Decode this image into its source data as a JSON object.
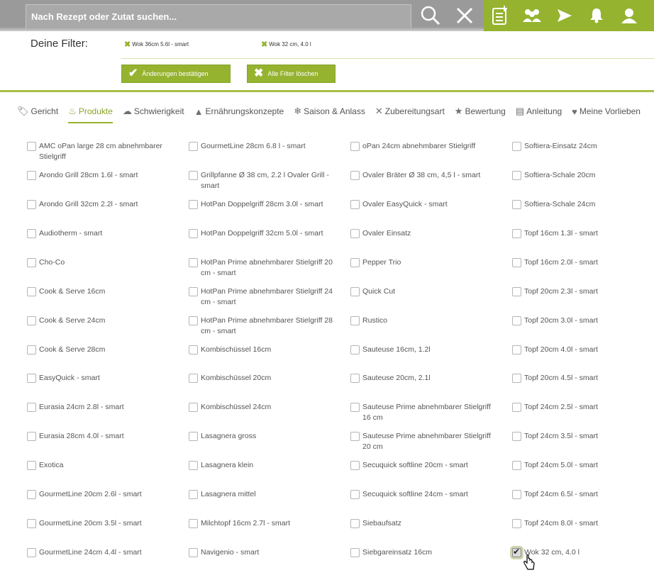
{
  "search": {
    "placeholder": "Nach Rezept oder Zutat suchen..."
  },
  "header_icons": [
    "search-icon",
    "close-icon",
    "recipe-book-icon",
    "community-icon",
    "send-icon",
    "bell-icon",
    "user-icon"
  ],
  "colors": {
    "accent": "#95b32f",
    "header": "#9a9a9a",
    "text": "#555555"
  },
  "filters": {
    "label": "Deine Filter:",
    "chips": [
      "Wok 36cm 5.6l - smart",
      "Wok 32 cm, 4.0 l"
    ],
    "confirm_label": "Änderungen bestätigen",
    "clear_label": "Alle Filter löschen"
  },
  "tabs": [
    {
      "label": "Gericht",
      "icon": "tag-icon"
    },
    {
      "label": "Produkte",
      "icon": "pot-icon",
      "active": true
    },
    {
      "label": "Schwierigkeit",
      "icon": "chef-hat-icon"
    },
    {
      "label": "Ernährungskonzepte",
      "icon": "pyramid-icon"
    },
    {
      "label": "Saison & Anlass",
      "icon": "snowflake-icon"
    },
    {
      "label": "Zubereitungsart",
      "icon": "utensils-icon"
    },
    {
      "label": "Bewertung",
      "icon": "star-icon"
    },
    {
      "label": "Anleitung",
      "icon": "document-icon"
    },
    {
      "label": "Meine Vorlieben",
      "icon": "heart-icon"
    }
  ],
  "products": {
    "col1": [
      "AMC oPan large 28 cm abnehmbarer Stielgriff",
      "Arondo Grill 28cm 1.6l - smart",
      "Arondo Grill 32cm 2.2l - smart",
      "Audiotherm - smart",
      "Cho-Co",
      "Cook & Serve 16cm",
      "Cook & Serve 24cm",
      "Cook & Serve 28cm",
      "EasyQuick - smart",
      "Eurasia 24cm 2.8l - smart",
      "Eurasia 28cm 4.0l - smart",
      "Exotica",
      "GourmetLine 20cm 2.6l - smart",
      "GourmetLine 20cm 3.5l - smart",
      "GourmetLine 24cm 4.4l - smart"
    ],
    "col2": [
      "GourmetLine 28cm 6.8 l - smart",
      "Grillpfanne Ø 38 cm, 2.2 l Ovaler Grill - smart",
      "HotPan Doppelgriff 28cm 3.0l - smart",
      "HotPan Doppelgriff 32cm 5.0l - smart",
      "HotPan Prime abnehmbarer Stielgriff 20 cm - smart",
      "HotPan Prime abnehmbarer Stielgriff 24 cm - smart",
      "HotPan Prime abnehmbarer Stielgriff 28 cm - smart",
      "Kombischüssel 16cm",
      "Kombischüssel 20cm",
      "Kombischüssel 24cm",
      "Lasagnera gross",
      "Lasagnera klein",
      "Lasagnera mittel",
      "Milchtopf 16cm 2.7l - smart",
      "Navigenio - smart"
    ],
    "col3": [
      "oPan 24cm abnehmbarer Stielgriff",
      "Ovaler Bräter Ø 38 cm, 4,5 l - smart",
      "Ovaler EasyQuick - smart",
      "Ovaler Einsatz",
      "Pepper Trio",
      "Quick Cut",
      "Rustico",
      "Sauteuse 16cm, 1.2l",
      "Sauteuse 20cm, 2.1l",
      "Sauteuse Prime abnehmbarer Stielgriff 16 cm",
      "Sauteuse Prime abnehmbarer Stielgriff 20 cm",
      "Secuquick softline 20cm - smart",
      "Secuquick softline 24cm - smart",
      "Siebaufsatz",
      "Siebgareinsatz 16cm"
    ],
    "col4": [
      "Softiera-Einsatz 24cm",
      "Softiera-Schale 20cm",
      "Softiera-Schale 24cm",
      "Topf 16cm 1.3l - smart",
      "Topf 16cm 2.0l - smart",
      "Topf 20cm 2.3l - smart",
      "Topf 20cm 3.0l - smart",
      "Topf 20cm 4.0l - smart",
      "Topf 20cm 4.5l - smart",
      "Topf 24cm 2.5l - smart",
      "Topf 24cm 3.5l - smart",
      "Topf 24cm 5.0l - smart",
      "Topf 24cm 6.5l - smart",
      "Topf 24cm 8.0l - smart",
      "Wok 32 cm, 4.0 l"
    ]
  },
  "checked": [
    "Wok 32 cm, 4.0 l"
  ]
}
